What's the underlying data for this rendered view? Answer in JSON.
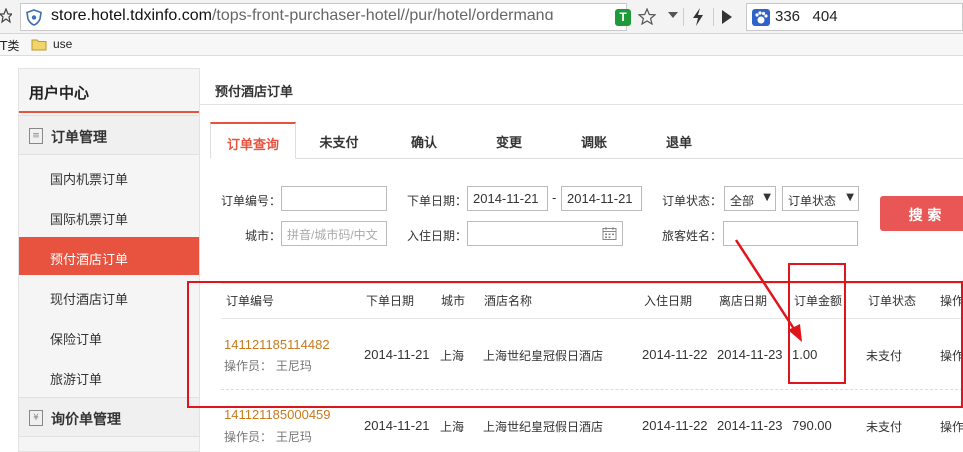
{
  "browser": {
    "url_host": "store.hotel.tdxinfo.com",
    "url_path": "/tops-front-purchaser-hotel//pur/hotel/ordermanɑ",
    "search_text": "336   404",
    "bookmark_1": "T类",
    "bookmark_2": "use"
  },
  "sidebar": {
    "title": "用户中心",
    "group_orders": "订单管理",
    "items": [
      "国内机票订单",
      "国际机票订单",
      "预付酒店订单",
      "现付酒店订单",
      "保险订单",
      "旅游订单"
    ],
    "group_inquiry": "询价单管理"
  },
  "page_title": "预付酒店订单",
  "tabs": [
    "订单查询",
    "未支付",
    "确认",
    "变更",
    "调账",
    "退单"
  ],
  "filters": {
    "order_no_label": "订单编号：",
    "order_date_label": "下单日期：",
    "date_from": "2014-11-21",
    "date_sep": "-",
    "date_to": "2014-11-21",
    "status_label": "订单状态：",
    "status_select_1": "全部",
    "status_select_2": "订单状态",
    "city_label": "城市：",
    "city_placeholder": "拼音/城市码/中文",
    "checkin_label": "入住日期：",
    "guest_label": "旅客姓名：",
    "search_button": "搜 索"
  },
  "table": {
    "headers": [
      "订单编号",
      "下单日期",
      "城市",
      "酒店名称",
      "入住日期",
      "离店日期",
      "订单金额",
      "订单状态",
      "操作"
    ],
    "rows": [
      {
        "order_no": "141121185114482",
        "operator": "操作员： 王尼玛",
        "order_date": "2014-11-21",
        "city": "上海",
        "hotel": "上海世纪皇冠假日酒店",
        "checkin": "2014-11-22",
        "checkout": "2014-11-23",
        "amount": "1.00",
        "status": "未支付",
        "action": "操作"
      },
      {
        "order_no": "141121185000459",
        "operator": "操作员： 王尼玛",
        "order_date": "2014-11-21",
        "city": "上海",
        "hotel": "上海世纪皇冠假日酒店",
        "checkin": "2014-11-22",
        "checkout": "2014-11-23",
        "amount": "790.00",
        "status": "未支付",
        "action": "操作"
      }
    ]
  },
  "colors": {
    "accent": "#e8533f",
    "link": "#c77a1d",
    "annotation": "#e0141b"
  }
}
